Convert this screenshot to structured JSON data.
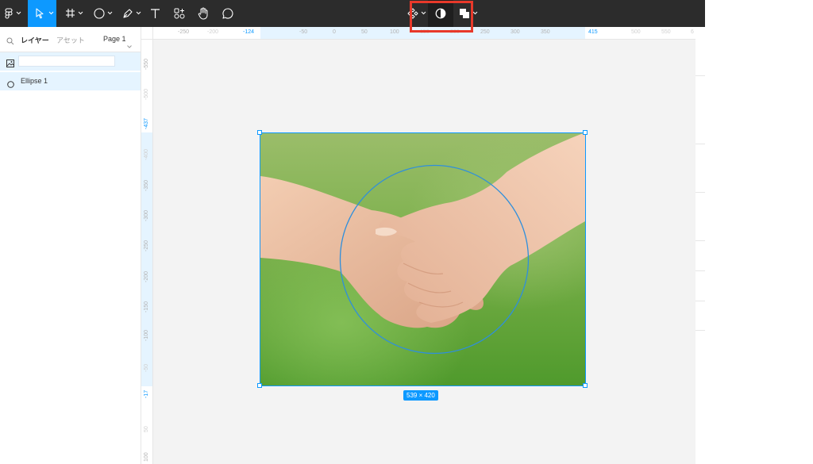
{
  "toolbar": {
    "tools": [
      {
        "id": "main-menu",
        "icon": "figma-logo-icon"
      },
      {
        "id": "move",
        "icon": "cursor-arrow-icon",
        "active": true
      },
      {
        "id": "frame",
        "icon": "hash-frame-icon"
      },
      {
        "id": "shape",
        "icon": "circle-shape-icon"
      },
      {
        "id": "pen",
        "icon": "pen-icon"
      },
      {
        "id": "text",
        "icon": "text-icon"
      },
      {
        "id": "resources",
        "icon": "resources-icon"
      },
      {
        "id": "hand",
        "icon": "hand-icon"
      },
      {
        "id": "comment",
        "icon": "comment-icon"
      },
      {
        "id": "component",
        "icon": "component-diamond-icon"
      },
      {
        "id": "mask",
        "icon": "mask-contrast-icon"
      },
      {
        "id": "boolean",
        "icon": "boolean-union-icon"
      }
    ]
  },
  "left_panel": {
    "tab_layers": "レイヤー",
    "tab_assets": "アセット",
    "page_label": "Page 1",
    "layers": [
      {
        "icon": "image-layer-icon",
        "name_value": ""
      },
      {
        "icon": "ellipse-layer-icon",
        "name": "Ellipse 1"
      }
    ]
  },
  "ruler_top": {
    "ticks": [
      "-250",
      "-200",
      "-124",
      "-50",
      "0",
      "50",
      "100",
      "150",
      "200",
      "250",
      "300",
      "350",
      "415",
      "500",
      "550",
      "6"
    ]
  },
  "ruler_left": {
    "ticks": [
      "-550",
      "-500",
      "-437",
      "-400",
      "-350",
      "-300",
      "-250",
      "-200",
      "-150",
      "-100",
      "-50",
      "-17",
      "50",
      "100"
    ]
  },
  "selection": {
    "size_label": "539 × 420"
  },
  "colors": {
    "toolbar_bg": "#2c2c2c",
    "accent": "#0d99ff",
    "highlight": "#e8392a",
    "canvas_bg": "#f3f3f3"
  }
}
